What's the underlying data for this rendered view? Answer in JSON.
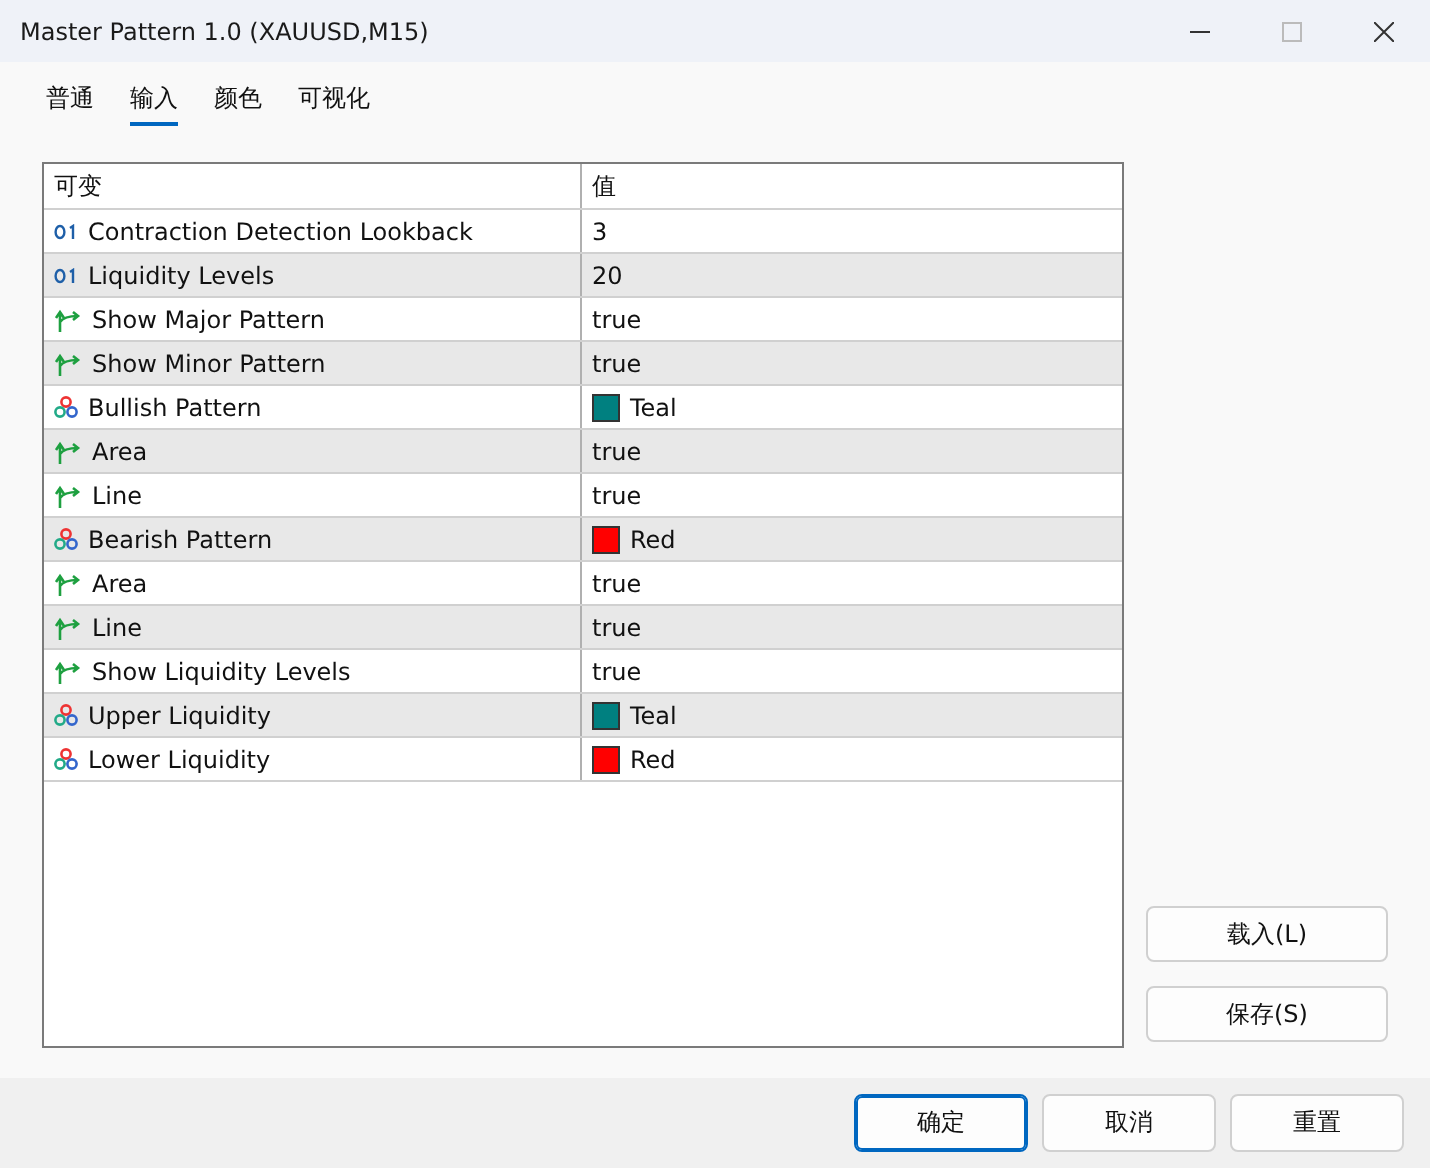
{
  "window": {
    "title": "Master Pattern 1.0 (XAUUSD,M15)"
  },
  "tabs": [
    {
      "label": "普通",
      "selected": false
    },
    {
      "label": "输入",
      "selected": true
    },
    {
      "label": "颜色",
      "selected": false
    },
    {
      "label": "可视化",
      "selected": false
    }
  ],
  "table": {
    "columns": [
      "可变",
      "值"
    ],
    "rows": [
      {
        "kind": "number",
        "name": "Contraction Detection Lookback",
        "value": "3"
      },
      {
        "kind": "number",
        "name": "Liquidity Levels",
        "value": "20"
      },
      {
        "kind": "bool",
        "name": "Show Major Pattern",
        "value": "true"
      },
      {
        "kind": "bool",
        "name": "Show Minor Pattern",
        "value": "true"
      },
      {
        "kind": "color",
        "name": "Bullish Pattern",
        "value": "Teal",
        "color": "#008080"
      },
      {
        "kind": "bool",
        "name": "Area",
        "value": "true"
      },
      {
        "kind": "bool",
        "name": "Line",
        "value": "true"
      },
      {
        "kind": "color",
        "name": "Bearish Pattern",
        "value": "Red",
        "color": "#ff0000"
      },
      {
        "kind": "bool",
        "name": "Area",
        "value": "true"
      },
      {
        "kind": "bool",
        "name": "Line",
        "value": "true"
      },
      {
        "kind": "bool",
        "name": "Show Liquidity Levels",
        "value": "true"
      },
      {
        "kind": "color",
        "name": "Upper Liquidity",
        "value": "Teal",
        "color": "#008080"
      },
      {
        "kind": "color",
        "name": "Lower Liquidity",
        "value": "Red",
        "color": "#ff0000"
      }
    ]
  },
  "side_buttons": [
    "载入(L)",
    "保存(S)"
  ],
  "footer_buttons": [
    {
      "label": "确定",
      "default": true
    },
    {
      "label": "取消",
      "default": false
    },
    {
      "label": "重置",
      "default": false
    }
  ]
}
